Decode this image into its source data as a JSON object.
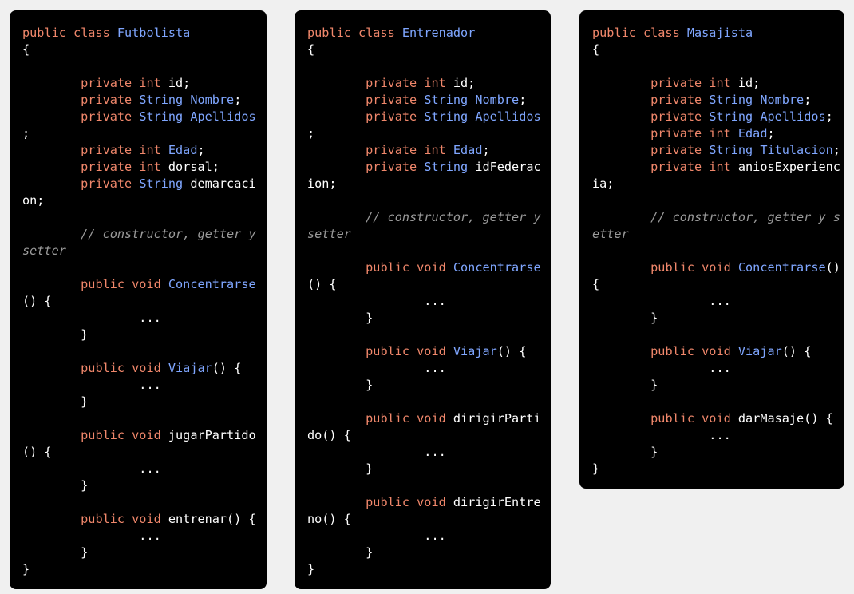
{
  "colors": {
    "background": "#f0f0f0",
    "panel": "#000000",
    "keyword": "#f0876b",
    "identifier": "#7fa6ff",
    "comment": "#9a9a9a",
    "text": "#ffffff"
  },
  "panels": [
    {
      "name": "futbolista",
      "lines": [
        [
          {
            "t": "public class ",
            "c": "kw"
          },
          {
            "t": "Futbolista",
            "c": "class"
          }
        ],
        [
          {
            "t": "{",
            "c": "plain"
          }
        ],
        [],
        [
          {
            "t": "        ",
            "c": "plain"
          },
          {
            "t": "private int ",
            "c": "kw"
          },
          {
            "t": "id;",
            "c": "plain"
          }
        ],
        [
          {
            "t": "        ",
            "c": "plain"
          },
          {
            "t": "private ",
            "c": "kw"
          },
          {
            "t": "String ",
            "c": "field"
          },
          {
            "t": "Nombre",
            "c": "field"
          },
          {
            "t": ";",
            "c": "plain"
          }
        ],
        [
          {
            "t": "        ",
            "c": "plain"
          },
          {
            "t": "private ",
            "c": "kw"
          },
          {
            "t": "String ",
            "c": "field"
          },
          {
            "t": "Apellidos",
            "c": "field"
          }
        ],
        [
          {
            "t": ";",
            "c": "plain"
          }
        ],
        [
          {
            "t": "        ",
            "c": "plain"
          },
          {
            "t": "private int ",
            "c": "kw"
          },
          {
            "t": "Edad",
            "c": "field"
          },
          {
            "t": ";",
            "c": "plain"
          }
        ],
        [
          {
            "t": "        ",
            "c": "plain"
          },
          {
            "t": "private int ",
            "c": "kw"
          },
          {
            "t": "dorsal;",
            "c": "plain"
          }
        ],
        [
          {
            "t": "        ",
            "c": "plain"
          },
          {
            "t": "private ",
            "c": "kw"
          },
          {
            "t": "String ",
            "c": "field"
          },
          {
            "t": "demarcaci",
            "c": "plain"
          }
        ],
        [
          {
            "t": "on;",
            "c": "plain"
          }
        ],
        [],
        [
          {
            "t": "        ",
            "c": "plain"
          },
          {
            "t": "// constructor, getter y",
            "c": "comment"
          }
        ],
        [
          {
            "t": "setter",
            "c": "comment"
          }
        ],
        [],
        [
          {
            "t": "        ",
            "c": "plain"
          },
          {
            "t": "public void ",
            "c": "kw"
          },
          {
            "t": "Concentrarse",
            "c": "class"
          }
        ],
        [
          {
            "t": "() {",
            "c": "plain"
          }
        ],
        [
          {
            "t": "                ...",
            "c": "plain"
          }
        ],
        [
          {
            "t": "        }",
            "c": "plain"
          }
        ],
        [],
        [
          {
            "t": "        ",
            "c": "plain"
          },
          {
            "t": "public void ",
            "c": "kw"
          },
          {
            "t": "Viajar",
            "c": "class"
          },
          {
            "t": "() {",
            "c": "plain"
          }
        ],
        [
          {
            "t": "                ...",
            "c": "plain"
          }
        ],
        [
          {
            "t": "        }",
            "c": "plain"
          }
        ],
        [],
        [
          {
            "t": "        ",
            "c": "plain"
          },
          {
            "t": "public void ",
            "c": "kw"
          },
          {
            "t": "jugarPartido",
            "c": "plain"
          }
        ],
        [
          {
            "t": "() {",
            "c": "plain"
          }
        ],
        [
          {
            "t": "                ...",
            "c": "plain"
          }
        ],
        [
          {
            "t": "        }",
            "c": "plain"
          }
        ],
        [],
        [
          {
            "t": "        ",
            "c": "plain"
          },
          {
            "t": "public void ",
            "c": "kw"
          },
          {
            "t": "entrenar() {",
            "c": "plain"
          }
        ],
        [
          {
            "t": "                ...",
            "c": "plain"
          }
        ],
        [
          {
            "t": "        }",
            "c": "plain"
          }
        ],
        [
          {
            "t": "}",
            "c": "plain"
          }
        ]
      ]
    },
    {
      "name": "entrenador",
      "lines": [
        [
          {
            "t": "public class ",
            "c": "kw"
          },
          {
            "t": "Entrenador",
            "c": "class"
          }
        ],
        [
          {
            "t": "{",
            "c": "plain"
          }
        ],
        [],
        [
          {
            "t": "        ",
            "c": "plain"
          },
          {
            "t": "private int ",
            "c": "kw"
          },
          {
            "t": "id;",
            "c": "plain"
          }
        ],
        [
          {
            "t": "        ",
            "c": "plain"
          },
          {
            "t": "private ",
            "c": "kw"
          },
          {
            "t": "String ",
            "c": "field"
          },
          {
            "t": "Nombre",
            "c": "field"
          },
          {
            "t": ";",
            "c": "plain"
          }
        ],
        [
          {
            "t": "        ",
            "c": "plain"
          },
          {
            "t": "private ",
            "c": "kw"
          },
          {
            "t": "String ",
            "c": "field"
          },
          {
            "t": "Apellidos",
            "c": "field"
          }
        ],
        [
          {
            "t": ";",
            "c": "plain"
          }
        ],
        [
          {
            "t": "        ",
            "c": "plain"
          },
          {
            "t": "private int ",
            "c": "kw"
          },
          {
            "t": "Edad",
            "c": "field"
          },
          {
            "t": ";",
            "c": "plain"
          }
        ],
        [
          {
            "t": "        ",
            "c": "plain"
          },
          {
            "t": "private ",
            "c": "kw"
          },
          {
            "t": "String ",
            "c": "field"
          },
          {
            "t": "idFederac",
            "c": "plain"
          }
        ],
        [
          {
            "t": "ion;",
            "c": "plain"
          }
        ],
        [],
        [
          {
            "t": "        ",
            "c": "plain"
          },
          {
            "t": "// constructor, getter y",
            "c": "comment"
          }
        ],
        [
          {
            "t": "setter",
            "c": "comment"
          }
        ],
        [],
        [
          {
            "t": "        ",
            "c": "plain"
          },
          {
            "t": "public void ",
            "c": "kw"
          },
          {
            "t": "Concentrarse",
            "c": "class"
          }
        ],
        [
          {
            "t": "() {",
            "c": "plain"
          }
        ],
        [
          {
            "t": "                ...",
            "c": "plain"
          }
        ],
        [
          {
            "t": "        }",
            "c": "plain"
          }
        ],
        [],
        [
          {
            "t": "        ",
            "c": "plain"
          },
          {
            "t": "public void ",
            "c": "kw"
          },
          {
            "t": "Viajar",
            "c": "class"
          },
          {
            "t": "() {",
            "c": "plain"
          }
        ],
        [
          {
            "t": "                ...",
            "c": "plain"
          }
        ],
        [
          {
            "t": "        }",
            "c": "plain"
          }
        ],
        [],
        [
          {
            "t": "        ",
            "c": "plain"
          },
          {
            "t": "public void ",
            "c": "kw"
          },
          {
            "t": "dirigirParti",
            "c": "plain"
          }
        ],
        [
          {
            "t": "do() {",
            "c": "plain"
          }
        ],
        [
          {
            "t": "                ...",
            "c": "plain"
          }
        ],
        [
          {
            "t": "        }",
            "c": "plain"
          }
        ],
        [],
        [
          {
            "t": "        ",
            "c": "plain"
          },
          {
            "t": "public void ",
            "c": "kw"
          },
          {
            "t": "dirigirEntre",
            "c": "plain"
          }
        ],
        [
          {
            "t": "no() {",
            "c": "plain"
          }
        ],
        [
          {
            "t": "                ...",
            "c": "plain"
          }
        ],
        [
          {
            "t": "        }",
            "c": "plain"
          }
        ],
        [
          {
            "t": "}",
            "c": "plain"
          }
        ]
      ]
    },
    {
      "name": "masajista",
      "lines": [
        [
          {
            "t": "public class ",
            "c": "kw"
          },
          {
            "t": "Masajista",
            "c": "class"
          }
        ],
        [
          {
            "t": "{",
            "c": "plain"
          }
        ],
        [],
        [
          {
            "t": "        ",
            "c": "plain"
          },
          {
            "t": "private int ",
            "c": "kw"
          },
          {
            "t": "id;",
            "c": "plain"
          }
        ],
        [
          {
            "t": "        ",
            "c": "plain"
          },
          {
            "t": "private ",
            "c": "kw"
          },
          {
            "t": "String ",
            "c": "field"
          },
          {
            "t": "Nombre",
            "c": "field"
          },
          {
            "t": ";",
            "c": "plain"
          }
        ],
        [
          {
            "t": "        ",
            "c": "plain"
          },
          {
            "t": "private ",
            "c": "kw"
          },
          {
            "t": "String ",
            "c": "field"
          },
          {
            "t": "Apellidos",
            "c": "field"
          },
          {
            "t": ";",
            "c": "plain"
          }
        ],
        [
          {
            "t": "        ",
            "c": "plain"
          },
          {
            "t": "private int ",
            "c": "kw"
          },
          {
            "t": "Edad",
            "c": "field"
          },
          {
            "t": ";",
            "c": "plain"
          }
        ],
        [
          {
            "t": "        ",
            "c": "plain"
          },
          {
            "t": "private ",
            "c": "kw"
          },
          {
            "t": "String ",
            "c": "field"
          },
          {
            "t": "Titulacion",
            "c": "field"
          },
          {
            "t": ";",
            "c": "plain"
          }
        ],
        [
          {
            "t": "        ",
            "c": "plain"
          },
          {
            "t": "private int ",
            "c": "kw"
          },
          {
            "t": "aniosExperienc",
            "c": "plain"
          }
        ],
        [
          {
            "t": "ia;",
            "c": "plain"
          }
        ],
        [],
        [
          {
            "t": "        ",
            "c": "plain"
          },
          {
            "t": "// constructor, getter y s",
            "c": "comment"
          }
        ],
        [
          {
            "t": "etter",
            "c": "comment"
          }
        ],
        [],
        [
          {
            "t": "        ",
            "c": "plain"
          },
          {
            "t": "public void ",
            "c": "kw"
          },
          {
            "t": "Concentrarse",
            "c": "class"
          },
          {
            "t": "()",
            "c": "plain"
          }
        ],
        [
          {
            "t": "{",
            "c": "plain"
          }
        ],
        [
          {
            "t": "                ...",
            "c": "plain"
          }
        ],
        [
          {
            "t": "        }",
            "c": "plain"
          }
        ],
        [],
        [
          {
            "t": "        ",
            "c": "plain"
          },
          {
            "t": "public void ",
            "c": "kw"
          },
          {
            "t": "Viajar",
            "c": "class"
          },
          {
            "t": "() {",
            "c": "plain"
          }
        ],
        [
          {
            "t": "                ...",
            "c": "plain"
          }
        ],
        [
          {
            "t": "        }",
            "c": "plain"
          }
        ],
        [],
        [
          {
            "t": "        ",
            "c": "plain"
          },
          {
            "t": "public void ",
            "c": "kw"
          },
          {
            "t": "darMasaje() {",
            "c": "plain"
          }
        ],
        [
          {
            "t": "                ...",
            "c": "plain"
          }
        ],
        [
          {
            "t": "        }",
            "c": "plain"
          }
        ],
        [
          {
            "t": "}",
            "c": "plain"
          }
        ]
      ]
    }
  ]
}
